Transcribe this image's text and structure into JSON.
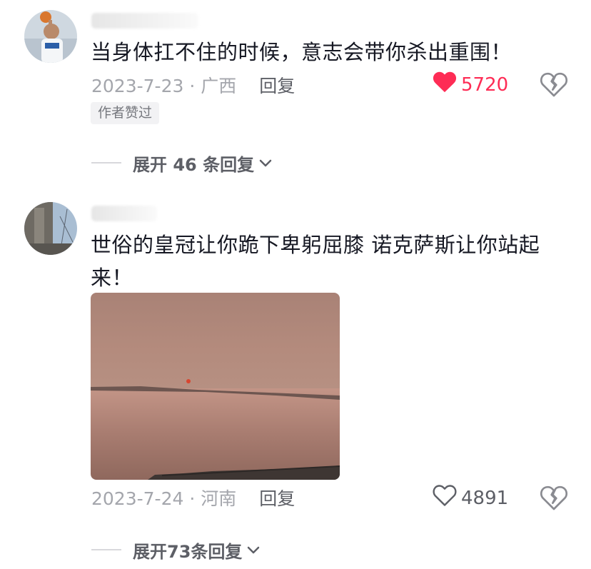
{
  "comments": [
    {
      "text": "当身体扛不住的时候，意志会带你杀出重围！",
      "date_location": "2023-7-23 · 广西",
      "reply_label": "回复",
      "likes": "5720",
      "liked": true,
      "badge": "作者赞过",
      "expand_label": "展开 46 条回复"
    },
    {
      "text": "世俗的皇冠让你跪下卑躬屈膝 诺克萨斯让你站起来！",
      "date_location": "2023-7-24 · 河南",
      "reply_label": "回复",
      "likes": "4891",
      "liked": false,
      "expand_label": "展开73条回复"
    }
  ],
  "colors": {
    "like_active": "#fe2c55",
    "meta_gray": "#a4a6ac",
    "reply_gray": "#5d5f66"
  },
  "icons": [
    "heart-filled-icon",
    "heart-outline-icon",
    "broken-heart-icon",
    "chevron-down-icon"
  ]
}
